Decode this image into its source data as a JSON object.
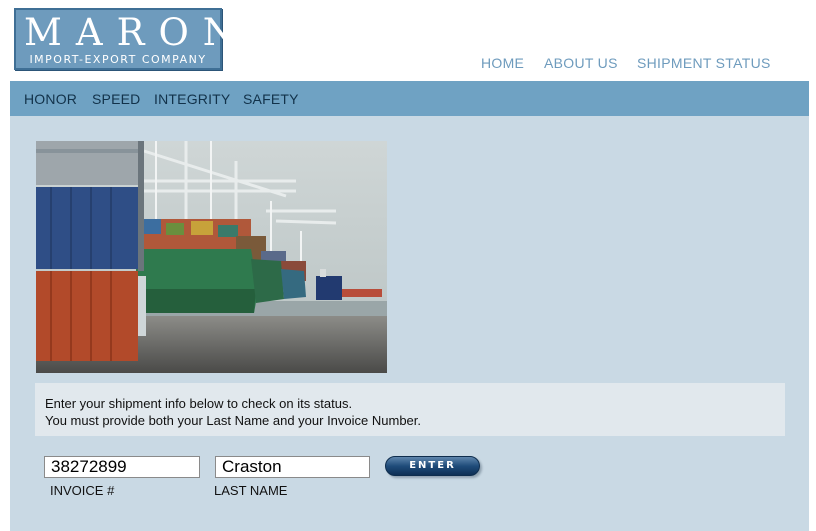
{
  "logo": {
    "title": "MARONI",
    "subtitle": "IMPORT-EXPORT COMPANY"
  },
  "top_nav": {
    "home": "HOME",
    "about": "ABOUT US",
    "status": "SHIPMENT STATUS"
  },
  "sub_nav": {
    "items": [
      "HONOR",
      "SPEED",
      "INTEGRITY",
      "SAFETY"
    ]
  },
  "info": {
    "line1": "Enter your shipment info below to check on its status.",
    "line2": "You must provide both your Last Name and your Invoice Number."
  },
  "form": {
    "invoice_value": "38272899",
    "invoice_label": "INVOICE #",
    "lastname_value": "Craston",
    "lastname_label": "LAST NAME",
    "enter_label": "ENTER"
  },
  "colors": {
    "brand": "#6e9bbd",
    "bar": "#6fa2c3",
    "panel": "#c9d9e4",
    "button": "#1f4c7a"
  }
}
